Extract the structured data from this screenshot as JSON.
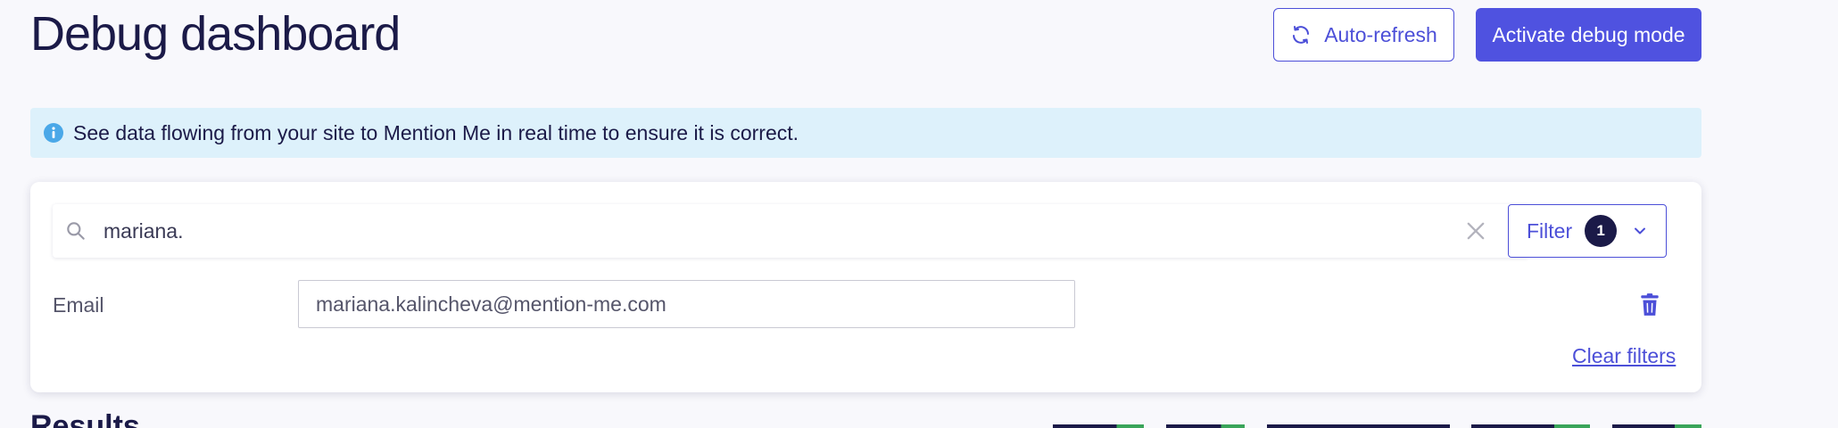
{
  "header": {
    "title": "Debug dashboard",
    "auto_refresh_label": "Auto-refresh",
    "activate_debug_label": "Activate debug mode"
  },
  "info_banner": {
    "text": "See data flowing from your site to Mention Me in real time to ensure it is correct."
  },
  "search": {
    "value": "mariana.",
    "search_icon": "search-icon",
    "clear_icon": "close-icon"
  },
  "filter": {
    "label": "Filter",
    "count": "1"
  },
  "filters": [
    {
      "field": "Email",
      "value": "mariana.kalincheva@mention-me.com",
      "remove_icon": "trash-icon"
    }
  ],
  "clear_filters_label": "Clear filters",
  "results": {
    "heading": "Results"
  },
  "colors": {
    "primary": "#4f52e0",
    "text_dark": "#1b1a48",
    "info_bg": "#ddf1fb",
    "info_icon": "#4aa8e8",
    "page_bg": "#f8f8fc"
  }
}
